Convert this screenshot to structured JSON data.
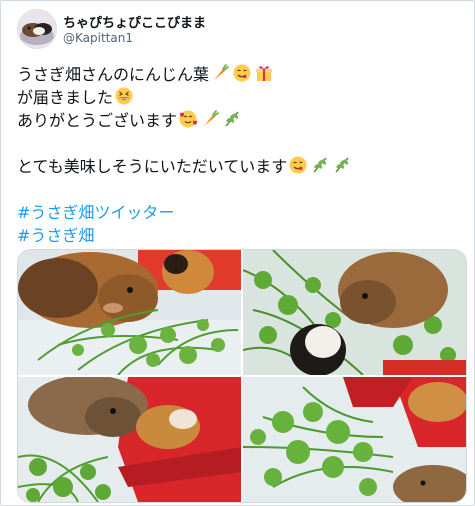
{
  "tweet": {
    "display_name": "ちゃぴちょぴここぴまま",
    "handle": "@Kapittan1",
    "lines": [
      "うさぎ畑さんのにんじん葉",
      "が届きました",
      "ありがとうございます"
    ],
    "line4": "とても美味しそうにいただいています",
    "hashtags": [
      "#うさぎ畑ツイッター",
      "#うさぎ畑"
    ]
  },
  "icons": {
    "avatar": "guinea-pig-avatar",
    "carrot": "carrot-emoji",
    "yum": "yum-face-emoji",
    "gift": "gift-emoji",
    "grin": "grinning-squinting-face-emoji",
    "hearts": "smiling-face-with-hearts-emoji",
    "herb": "herb-emoji"
  },
  "colors": {
    "hashtag": "#1d9bf0",
    "text": "#0f1419",
    "secondary": "#536471",
    "border": "#cfd9de"
  }
}
